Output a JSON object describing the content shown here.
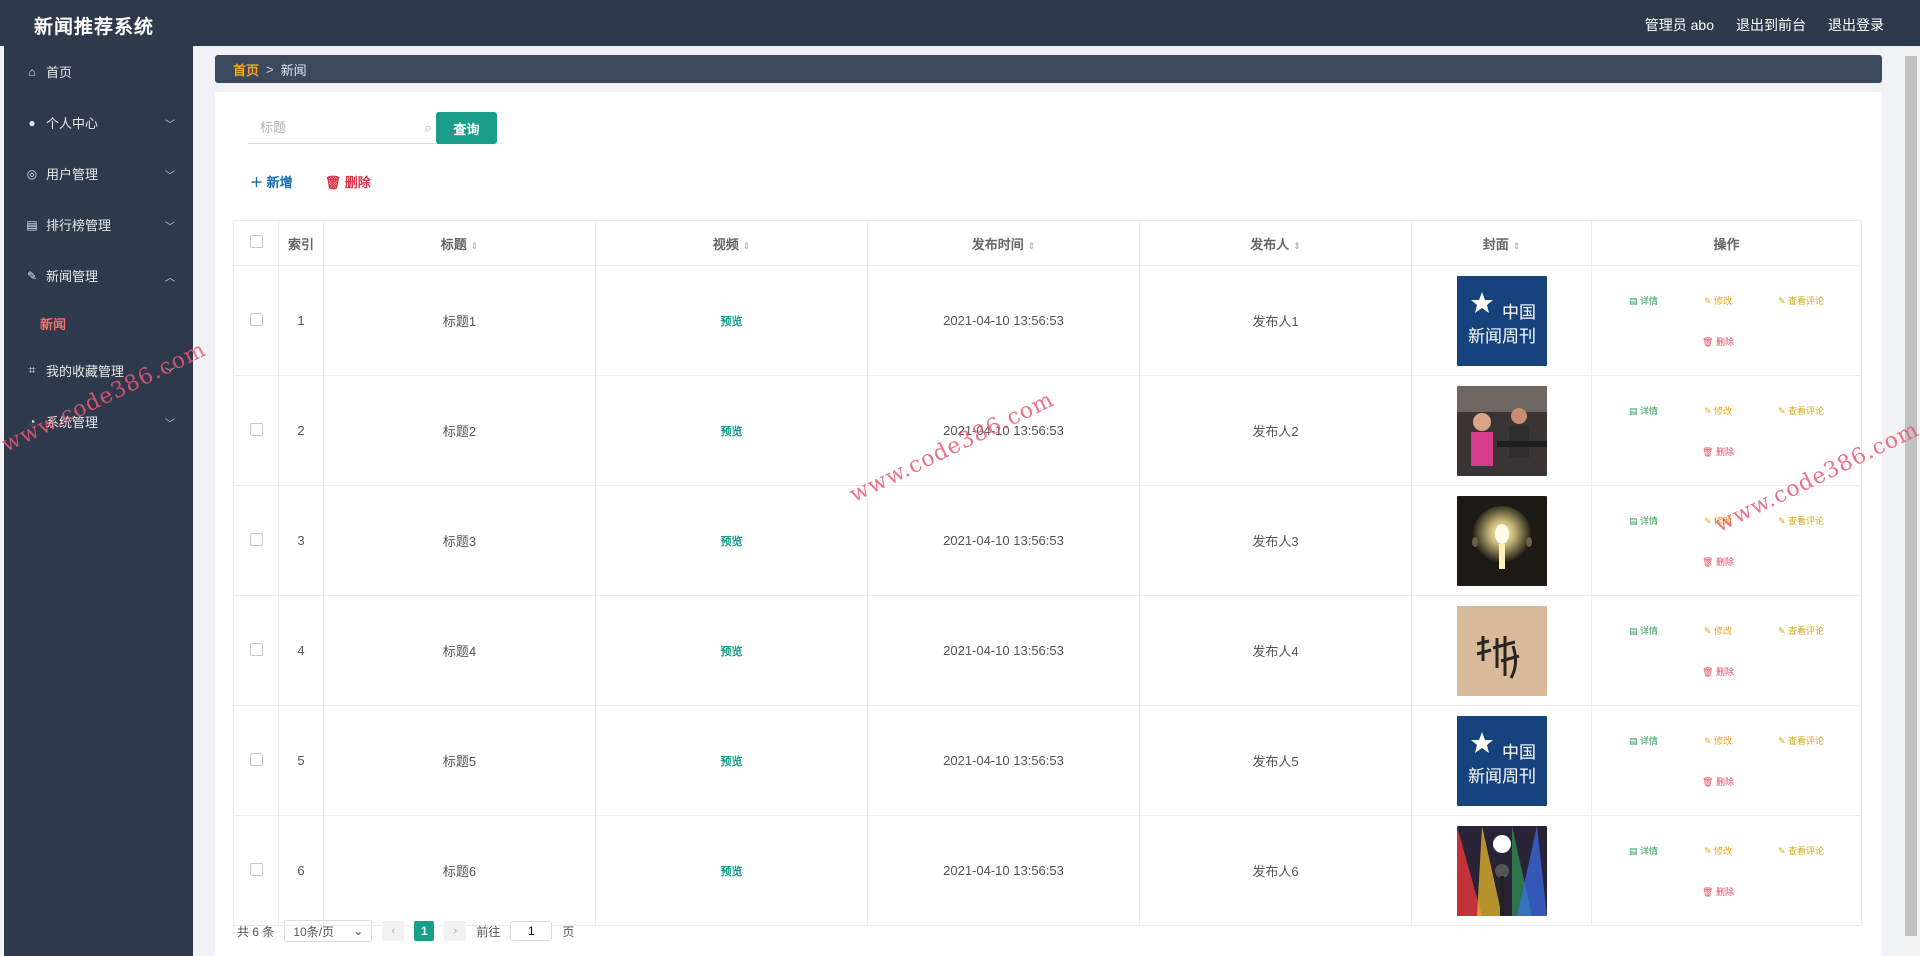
{
  "app": {
    "title": "新闻推荐系统"
  },
  "top_links": [
    "管理员 abo",
    "退出到前台",
    "退出登录"
  ],
  "sidebar": {
    "items": [
      {
        "label": "首页",
        "icon": "home-icon",
        "glyph": "⌂",
        "expandable": false
      },
      {
        "label": "个人中心",
        "icon": "user-icon",
        "glyph": "●",
        "expandable": true
      },
      {
        "label": "用户管理",
        "icon": "circle-user-icon",
        "glyph": "◎",
        "expandable": true
      },
      {
        "label": "排行榜管理",
        "icon": "briefcase-icon",
        "glyph": "▤",
        "expandable": true
      },
      {
        "label": "新闻管理",
        "icon": "edit-icon",
        "glyph": "✎",
        "expandable": true,
        "expanded": true
      },
      {
        "label": "我的收藏管理",
        "icon": "crop-icon",
        "glyph": "⌗",
        "expandable": true
      },
      {
        "label": "系统管理",
        "icon": "gauge-icon",
        "glyph": "◔",
        "expandable": true
      }
    ],
    "submenu_label": "新闻"
  },
  "breadcrumb": {
    "home": "首页",
    "separator": ">",
    "current": "新闻"
  },
  "search": {
    "placeholder": "标题",
    "button": "查询"
  },
  "actions": {
    "add": "＋ 新增",
    "delete": "删除"
  },
  "table": {
    "headers": [
      "索引",
      "标题",
      "视频",
      "发布时间",
      "发布人",
      "封面",
      "操作"
    ],
    "preview_label": "预览",
    "ops": {
      "detail": "详情",
      "edit": "修改",
      "comment": "查看评论",
      "delete": "删除"
    },
    "rows": [
      {
        "index": "1",
        "title": "标题1",
        "time": "2021-04-10 13:56:53",
        "author": "发布人1",
        "cover": "china-newsweek-logo"
      },
      {
        "index": "2",
        "title": "标题2",
        "time": "2021-04-10 13:56:53",
        "author": "发布人2",
        "cover": "gym-photo"
      },
      {
        "index": "3",
        "title": "标题3",
        "time": "2021-04-10 13:56:53",
        "author": "发布人3",
        "cover": "lightbulb-photo"
      },
      {
        "index": "4",
        "title": "标题4",
        "time": "2021-04-10 13:56:53",
        "author": "发布人4",
        "cover": "calligraphy-photo"
      },
      {
        "index": "5",
        "title": "标题5",
        "time": "2021-04-10 13:56:53",
        "author": "发布人5",
        "cover": "china-newsweek-logo"
      },
      {
        "index": "6",
        "title": "标题6",
        "time": "2021-04-10 13:56:53",
        "author": "发布人6",
        "cover": "microphone-stage-photo"
      }
    ]
  },
  "pager": {
    "total": "共 6 条",
    "page_size": "10条/页",
    "current_page": "1",
    "goto_prefix": "前往",
    "goto_value": "1",
    "goto_suffix": "页"
  },
  "watermark": "www.code386.com",
  "colors": {
    "topbar": "#2e3a4c",
    "accent": "#1a9e8a",
    "breadcrumb_home": "#f5a623",
    "delete": "#d9364d"
  }
}
